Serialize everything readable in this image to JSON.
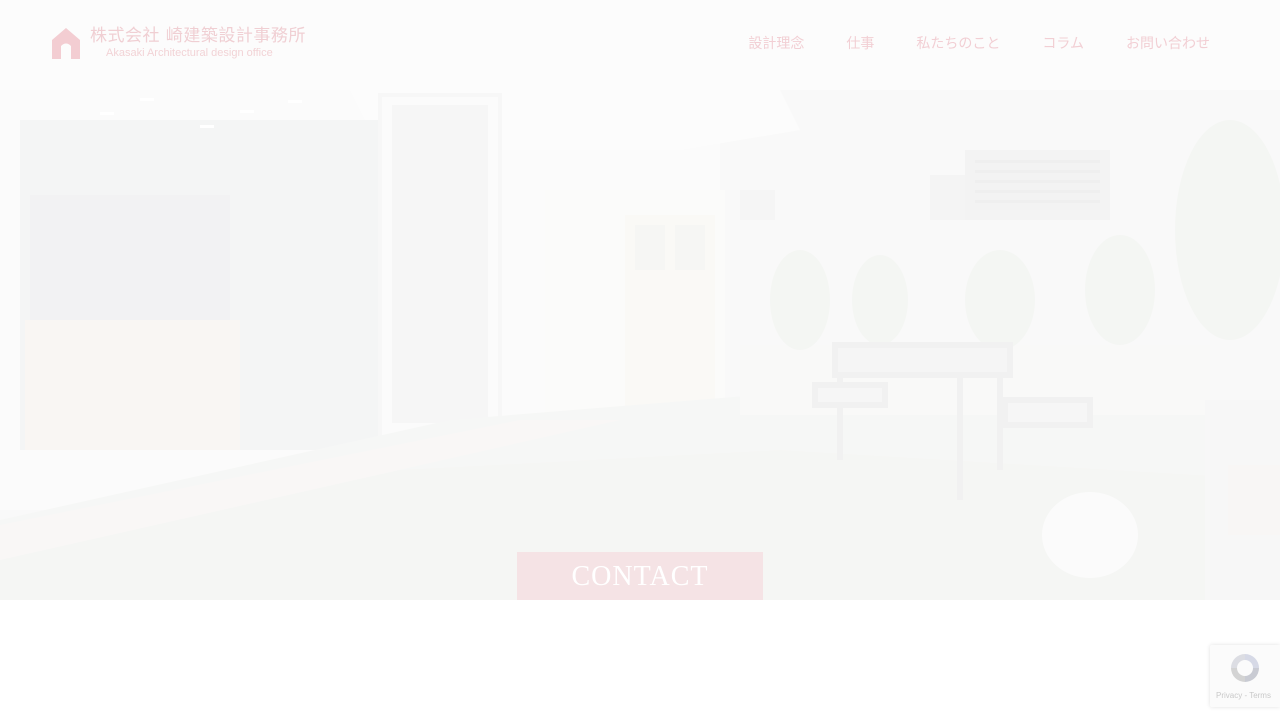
{
  "header": {
    "logo": {
      "name_ja": "株式会社 崎建築設計事務所",
      "name_en": "Akasaki Architectural design office"
    },
    "nav": [
      {
        "label": "設計理念"
      },
      {
        "label": "仕事"
      },
      {
        "label": "私たちのこと"
      },
      {
        "label": "コラム"
      },
      {
        "label": "お問い合わせ"
      }
    ]
  },
  "hero": {
    "cta_label": "CONTACT"
  },
  "recaptcha": {
    "links": "Privacy - Terms"
  },
  "colors": {
    "accent_pink": "#f0cfd3",
    "cta_background": "#f5dee0",
    "header_background": "#fcfcfc"
  }
}
